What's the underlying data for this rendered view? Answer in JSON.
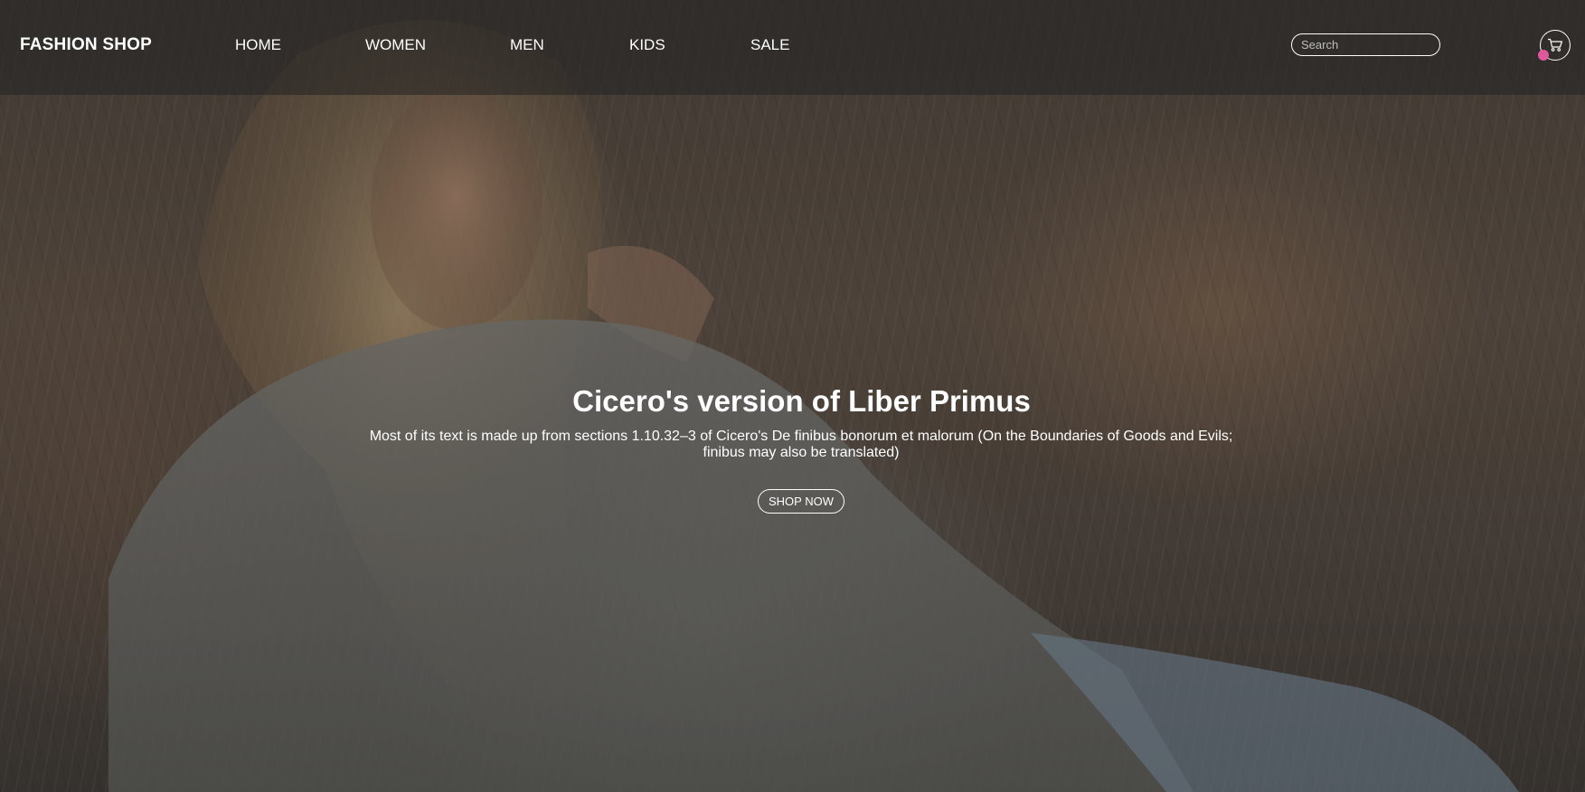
{
  "header": {
    "brand": "FASHION SHOP",
    "nav": [
      {
        "label": "HOME"
      },
      {
        "label": "WOMEN"
      },
      {
        "label": "MEN"
      },
      {
        "label": "KIDS"
      },
      {
        "label": "SALE"
      }
    ],
    "search": {
      "placeholder": "Search",
      "value": ""
    },
    "cart": {
      "icon": "shopping-cart-icon",
      "badge_color": "#e0589c"
    }
  },
  "hero": {
    "title": "Cicero's version of Liber Primus",
    "description": "Most of its text is made up from sections 1.10.32–3 of Cicero's De finibus bonorum et malorum (On the Boundaries of Goods and Evils; finibus may also be translated)",
    "cta_label": "SHOP NOW",
    "overlay_color": "#000000"
  }
}
